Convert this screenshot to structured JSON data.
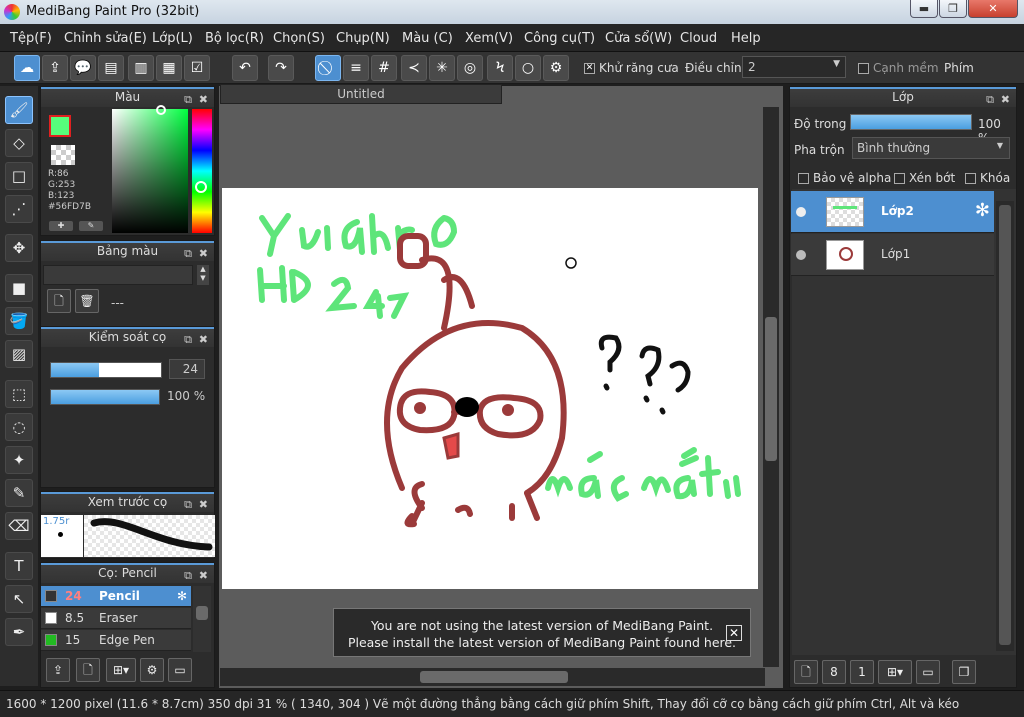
{
  "window": {
    "title": "MediBang Paint Pro (32bit)",
    "min": "▬",
    "max": "❐",
    "close": "✕"
  },
  "menu": [
    "Tệp(F)",
    "Chỉnh sửa(E)",
    "Lớp(L)",
    "Bộ lọc(R)",
    "Chọn(S)",
    "Chụp(N)",
    "Màu (C)",
    "Xem(V)",
    "Công cụ(T)",
    "Cửa sổ(W)",
    "Cloud",
    "Help"
  ],
  "toolbar": {
    "antialias_label": "Khử răng cưa",
    "correction_label": "Điều chỉnh",
    "correction_value": "2",
    "soft_edge_label": "Cạnh mềm",
    "keys_label": "Phím"
  },
  "color_panel": {
    "title": "Màu",
    "r": "R:86",
    "g": "G:253",
    "b": "B:123",
    "hex": "#56FD7B",
    "primary_color": "#56FD7B"
  },
  "palette_panel": {
    "title": "Bảng màu",
    "label": "---"
  },
  "brush_control": {
    "title": "Kiểm soát cọ",
    "size": "24",
    "opacity": "100 %",
    "size_fraction": 0.44,
    "opacity_fraction": 1.0
  },
  "brush_preview": {
    "title": "Xem trước cọ",
    "size_label": "1.75r"
  },
  "brush_list": {
    "title": "Cọ: Pencil",
    "items": [
      {
        "size": "24",
        "name": "Pencil",
        "color": "#333333"
      },
      {
        "size": "8.5",
        "name": "Eraser",
        "color": "#ffffff"
      },
      {
        "size": "15",
        "name": "Edge Pen",
        "color": "#22bb22"
      }
    ]
  },
  "document": {
    "tab": "Untitled"
  },
  "drawing": {
    "text1": "Yuichiro",
    "text2": "HD 2 47",
    "text3": "???",
    "text4": "mác mắt!!"
  },
  "notice": {
    "line1": "You are not using the latest version of MediBang Paint.",
    "line2": "Please install the latest version of MediBang Paint found here."
  },
  "layer_panel": {
    "title": "Lớp",
    "opacity_label": "Độ trong",
    "opacity_value": "100 %",
    "opacity_fraction": 1.0,
    "blend_label": "Pha trộn",
    "blend_value": "Bình thường",
    "protect_alpha": "Bảo vệ alpha",
    "clipping": "Xén bớt",
    "lock": "Khóa",
    "layers": [
      {
        "name": "Lớp2",
        "selected": true
      },
      {
        "name": "Lớp1",
        "selected": false
      }
    ]
  },
  "status": {
    "text": "1600 * 1200 pixel   (11.6 * 8.7cm)   350 dpi   31 %   ( 1340, 304 )   Vẽ một đường thẳng bằng cách giữ phím Shift, Thay đổi cỡ cọ bằng cách giữ phím Ctrl, Alt và kéo"
  }
}
